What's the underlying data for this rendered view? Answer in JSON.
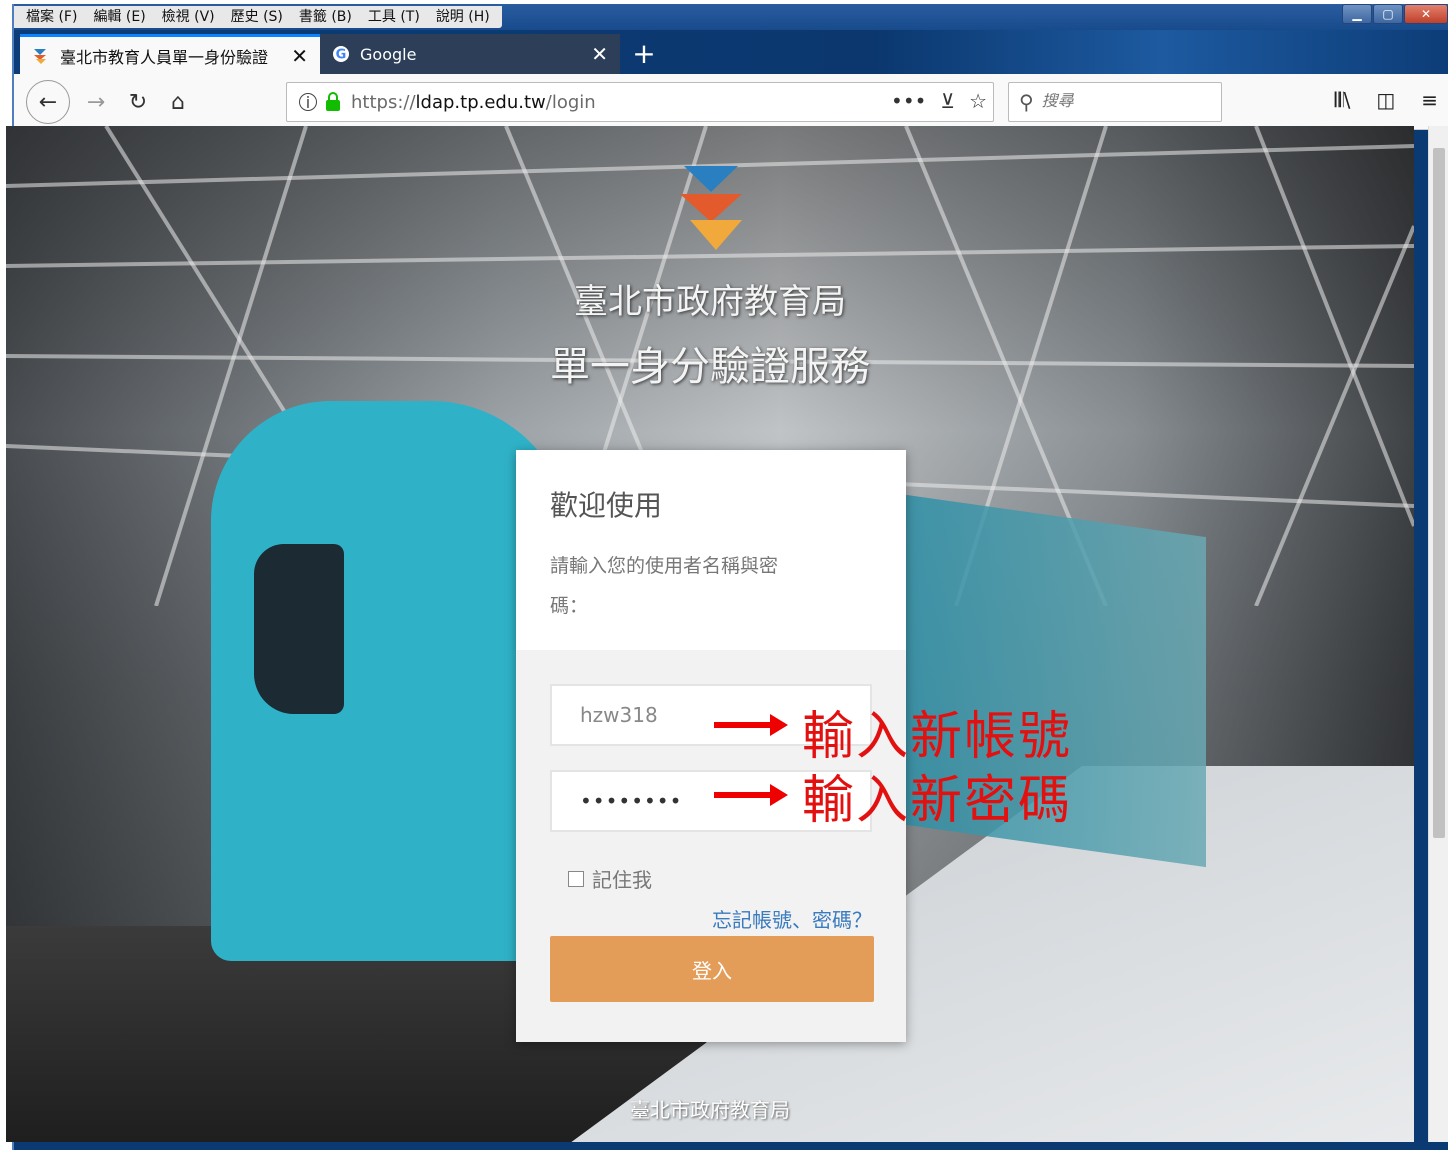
{
  "menubar": {
    "items": [
      "檔案 (F)",
      "編輯 (E)",
      "檢視 (V)",
      "歷史 (S)",
      "書籤 (B)",
      "工具 (T)",
      "說明 (H)"
    ]
  },
  "tabs": [
    {
      "title": "臺北市教育人員單一身份驗證",
      "active": true
    },
    {
      "title": "Google",
      "active": false
    }
  ],
  "urlbar": {
    "prefix": "https://",
    "domain": "ldap.tp.edu.tw",
    "path": "/login"
  },
  "search": {
    "placeholder": "搜尋"
  },
  "page": {
    "title_line1": "臺北市政府教育局",
    "title_line2": "單一身分驗證服務",
    "footer": "臺北市政府教育局"
  },
  "login": {
    "heading": "歡迎使用",
    "description": "請輸入您的使用者名稱與密碼：",
    "username_value": "hzw318",
    "password_value": "••••••••",
    "remember_label": "記住我",
    "forgot_link": "忘記帳號、密碼？",
    "submit_label": "登入"
  },
  "annotations": {
    "username_note": "輸入新帳號",
    "password_note": "輸入新密碼"
  },
  "colors": {
    "login_button": "#e39d58",
    "annotation": "#e31010",
    "link": "#3a7bbf"
  }
}
